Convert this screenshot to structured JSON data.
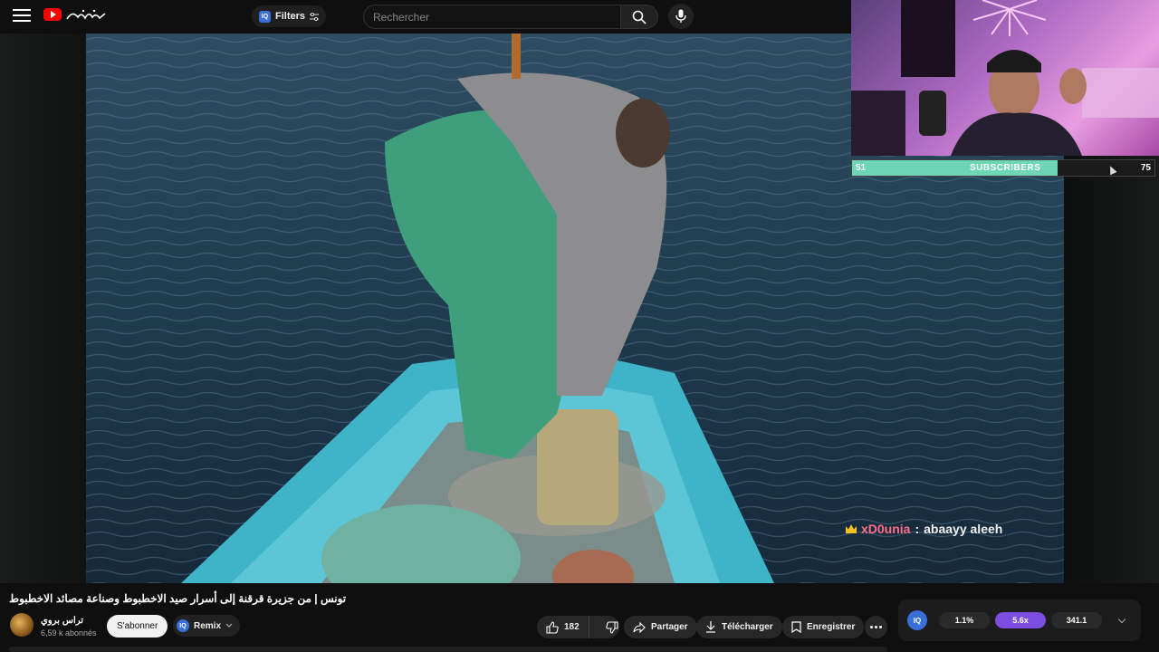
{
  "header": {
    "filters_label": "Filters",
    "iq_text": "IQ",
    "search_placeholder": "Rechercher"
  },
  "overlay": {
    "subscribers": {
      "current": "51",
      "label": "SUBSCRIBERS",
      "goal": "75",
      "progress_fraction": 0.68
    },
    "chat": {
      "user": "xD0unia",
      "separator": ":",
      "message": "abaayy aleeh"
    }
  },
  "video": {
    "title": "تونس | من جزيرة قرقنة إلى أسرار صيد الاخطبوط وصناعة مصائد الاخطبوط"
  },
  "channel": {
    "name": "تراس بروي",
    "subscribers": "6,59 k abonnés",
    "subscribe_label": "S'abonner",
    "remix_label": "Remix"
  },
  "actions": {
    "like_count": "182",
    "share_label": "Partager",
    "download_label": "Télécharger",
    "save_label": "Enregistrer"
  },
  "speed_panel": {
    "iq_text": "IQ",
    "chip_1": "1.1%",
    "chip_2": "5.6x",
    "chip_3": "341.1"
  },
  "colors": {
    "accent_red": "#ff0000",
    "subscriber_bar": "#6fd6b5",
    "speed_active": "#7d4ce0",
    "chat_username": "#ff6e88"
  }
}
